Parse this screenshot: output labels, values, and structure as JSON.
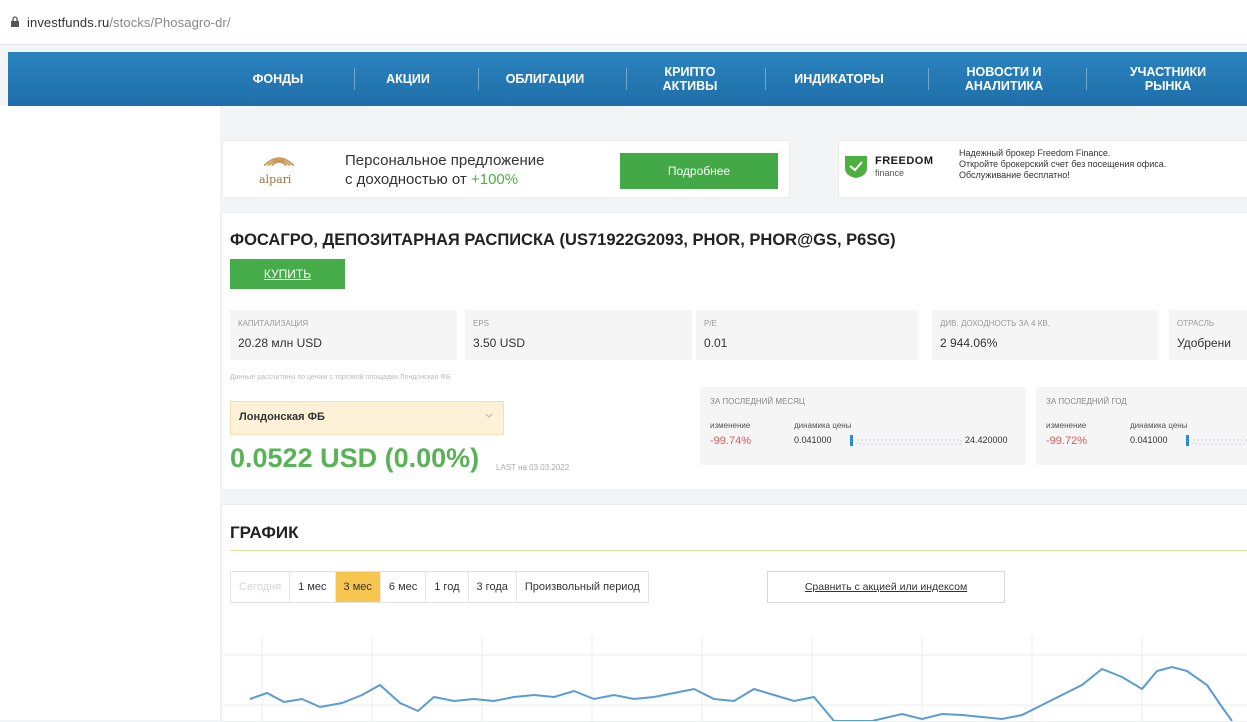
{
  "browser": {
    "domain": "investfunds.ru",
    "path": "/stocks/Phosagro-dr/"
  },
  "nav": [
    "ФОНДЫ",
    "АКЦИИ",
    "ОБЛИГАЦИИ",
    "КРИПТО\nАКТИВЫ",
    "ИНДИКАТОРЫ",
    "НОВОСТИ И\nАНАЛИТИКА",
    "УЧАСТНИКИ\nРЫНКА"
  ],
  "ad_alpari": {
    "brand": "alpari",
    "line1": "Персональное предложение",
    "line2_prefix": "с доходностью от ",
    "line2_highlight": "+100%",
    "button": "Подробнее"
  },
  "ad_freedom": {
    "brand": "FREEDOM",
    "brand_sub": "finance",
    "line1": "Надежный брокер Freedom Finance.",
    "line2": "Откройте брокерский счет без посещения офиса.",
    "line3": "Обслуживание бесплатно!"
  },
  "stock": {
    "title": "ФОСАГРО, ДЕПОЗИТАРНАЯ РАСПИСКА (US71922G2093, PHOR, PHOR@GS, P6SG)",
    "buy_button": "КУПИТЬ",
    "metrics": [
      {
        "label": "Капитализация",
        "value": "20.28 млн USD"
      },
      {
        "label": "EPS",
        "value": "3.50 USD"
      },
      {
        "label": "P/E",
        "value": "0.01"
      },
      {
        "label": "Див. доходность за 4 кв.",
        "value": "2 944.06%"
      },
      {
        "label": "Отрасль",
        "value": "Удобрени"
      }
    ],
    "note": "Данные рассчитаны по ценам с торговой площадки Лондонская ФБ",
    "exchange": "Лондонская ФБ",
    "price": "0.0522 USD (0.00%)",
    "last": "LAST на 03.03.2022"
  },
  "perf_month": {
    "header": "За последний месяц",
    "change_label": "изменение",
    "change_value": "-99.74%",
    "dynamics_label": "динамика цены",
    "min": "0.041000",
    "max": "24.420000"
  },
  "perf_year": {
    "header": "За последний год",
    "change_label": "изменение",
    "change_value": "-99.72%",
    "dynamics_label": "динамика цены",
    "min": "0.041000"
  },
  "chart_section": {
    "title": "ГРАФИК",
    "tabs": [
      "Сегодня",
      "1 мес",
      "3 мес",
      "6 мес",
      "1 год",
      "3 года",
      "Произвольный период"
    ],
    "active_tab": "3 мес",
    "compare": "Сравнить с акцией или индексом"
  },
  "colors": {
    "nav": "#2275b0",
    "green": "#43a947",
    "active_tab": "#f7c64e",
    "line": "#5b9bd5"
  }
}
